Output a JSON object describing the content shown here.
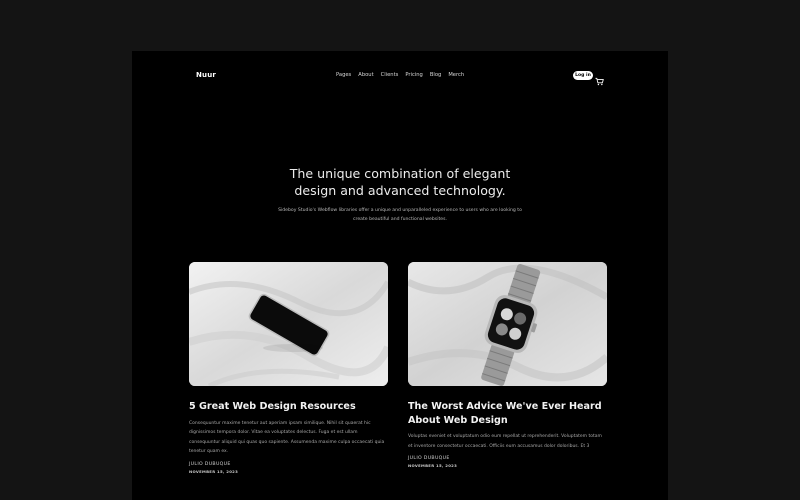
{
  "nav": {
    "logo": "Nuur",
    "links": [
      "Pages",
      "About",
      "Clients",
      "Pricing",
      "Blog",
      "Merch"
    ],
    "login_label": "Log in",
    "cart_icon": "cart-icon"
  },
  "hero": {
    "title_line1": "The unique combination of elegant",
    "title_line2": "design and advanced technology.",
    "subtitle": "Sideboy Studio's Webflow libraries offer a unique and unparalleled experience to users who are looking to create beautiful and functional websites."
  },
  "posts": [
    {
      "title": "5 Great Web Design Resources",
      "excerpt": "Consequuntur maxime tenetur aut aperiam ipsam similique. Nihil sit quaerat hic dignissimos tempora dolor. Vitae ea voluptates delectus. Fuga et est ullam consequuntur aliquid qui quas quo sapiente. Assumenda maxime culpa occaecati quia tenetur quam ex.",
      "author": "JULIO DUBUQUE",
      "date": "NOVEMBER 15, 2023"
    },
    {
      "title": "The Worst Advice We've Ever Heard About Web Design",
      "excerpt": "Voluptas eveniet et voluptatum odio eum repellat ut reprehenderit. Voluptatem totam et inventore consectetur occaecati. Officiis eum accusamus dolor doloribus. Et 3",
      "author": "JULIO DUBUQUE",
      "date": "NOVEMBER 15, 2023"
    }
  ]
}
